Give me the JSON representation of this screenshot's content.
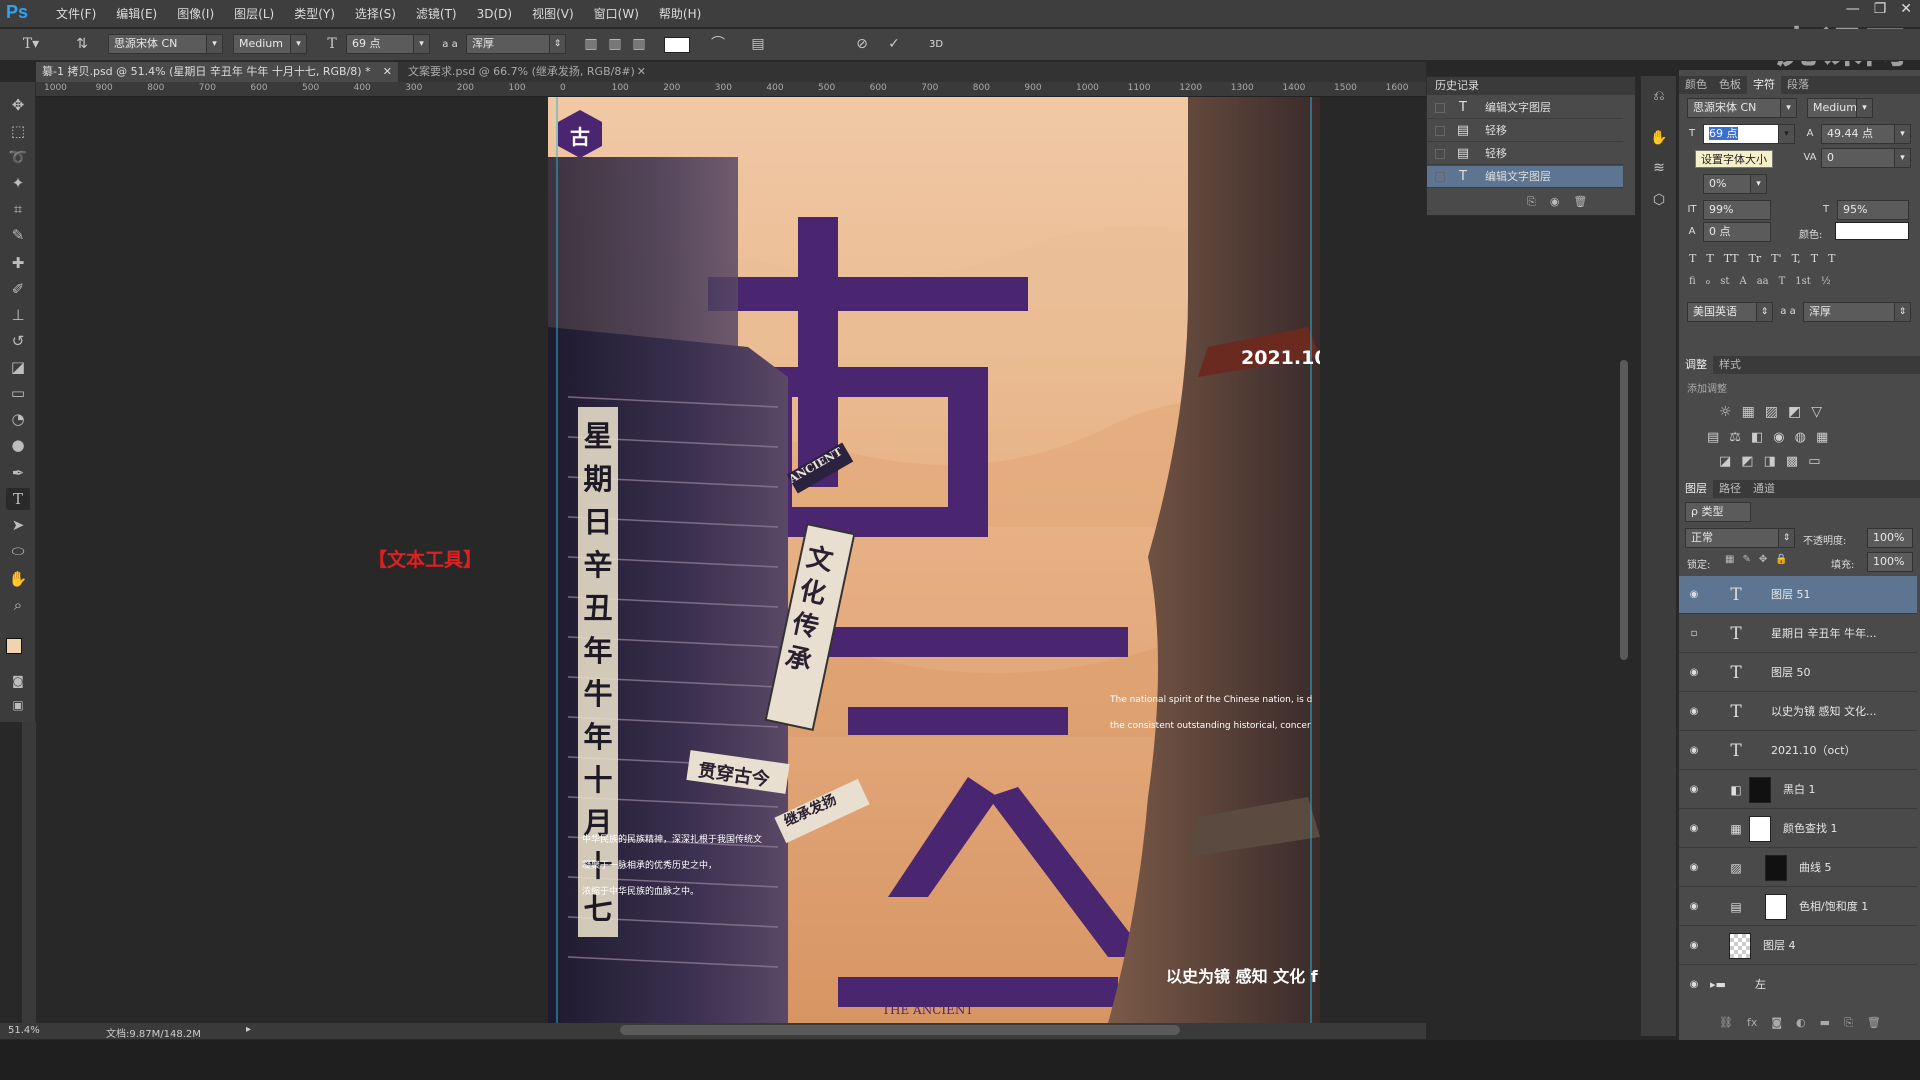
{
  "app": {
    "logo": "Ps"
  },
  "menu": [
    "文件(F)",
    "编辑(E)",
    "图像(I)",
    "图层(L)",
    "类型(Y)",
    "选择(S)",
    "滤镜(T)",
    "3D(D)",
    "视图(V)",
    "窗口(W)",
    "帮助(H)"
  ],
  "window_controls": [
    "—",
    "❐",
    "✕"
  ],
  "watermark": "虎课网",
  "options": {
    "font_family": "思源宋体 CN",
    "font_style": "Medium",
    "font_size": "69 点",
    "aa_mode": "浑厚",
    "aa_label": "a a",
    "three_d": "3D"
  },
  "tabs": [
    {
      "label": "纂-1 拷贝.psd @ 51.4% (星期日 辛丑年 牛年 十月十七, RGB/8) *",
      "close": "✕",
      "active": true
    },
    {
      "label": "文案要求.psd @ 66.7% (继承发扬, RGB/8#)",
      "close": "✕",
      "active": false
    }
  ],
  "ruler_labels": [
    "1000",
    "900",
    "800",
    "700",
    "600",
    "500",
    "400",
    "300",
    "200",
    "100",
    "0",
    "100",
    "200",
    "300",
    "400",
    "500",
    "600",
    "700",
    "800",
    "900",
    "1000",
    "1100",
    "1200",
    "1300",
    "1400",
    "1500",
    "1600"
  ],
  "canvas": {
    "annotation": "【文本工具】",
    "poster": {
      "badge": "古",
      "big_chars": [
        "古",
        "与",
        "今"
      ],
      "date": "2021.10",
      "vertical_date": [
        "星",
        "期",
        "日",
        "辛",
        "丑",
        "年",
        "牛",
        "年",
        "十",
        "月",
        "十",
        "七"
      ],
      "sign_ancient": "ANCIENT",
      "sign_culture": "文化传承",
      "sign_through": "贯穿古今",
      "sign_inherit": "继承发扬",
      "en_line1": "The national spirit of the Chinese nation, is d",
      "en_line2": "the consistent outstanding historical, concer",
      "cn_lines": [
        "中华民族的民族精神，深深扎根于我国传统文",
        "凝聚于一脉相承的优秀历史之中，",
        "浓缩于中华民族的血脉之中。"
      ],
      "cn_caption": "以史为镜 感知 文化 f",
      "footer": "THE ANCIENT"
    }
  },
  "status": {
    "zoom": "51.4%",
    "doc": "文档:9.87M/148.2M"
  },
  "history": {
    "title": "历史记录",
    "items": [
      {
        "label": "编辑文字图层",
        "icon": "T",
        "selected": false
      },
      {
        "label": "轻移",
        "icon": "▤",
        "selected": false
      },
      {
        "label": "轻移",
        "icon": "▤",
        "selected": false
      },
      {
        "label": "编辑文字图层",
        "icon": "T",
        "selected": true
      }
    ]
  },
  "character": {
    "tabs": [
      "颜色",
      "色板",
      "字符",
      "段落"
    ],
    "font_family": "思源宋体 CN",
    "font_style": "Medium",
    "size_value": "69 点",
    "leading": "49.44 点",
    "tracking": "0",
    "tooltip": "设置字体大小",
    "scale_pct": "0%",
    "vscale": "99%",
    "hscale": "95%",
    "baseline": "0 点",
    "color_label": "颜色:",
    "style_buttons": [
      "T",
      "T",
      "TT",
      "Tr",
      "T'",
      "T,",
      "T",
      "T"
    ],
    "ot_buttons": [
      "fi",
      "ℴ",
      "st",
      "A",
      "aa",
      "T",
      "1st",
      "½"
    ],
    "language": "美国英语",
    "aa_label": "a a",
    "aa_mode": "浑厚"
  },
  "adjustments": {
    "tabs": [
      "调整",
      "样式"
    ],
    "title": "添加调整"
  },
  "layers": {
    "tabs": [
      "图层",
      "路径",
      "通道"
    ],
    "filter": "ρ 类型",
    "blend": "正常",
    "opacity_label": "不透明度:",
    "opacity": "100%",
    "lock_label": "锁定:",
    "fill_label": "填充:",
    "fill": "100%",
    "items": [
      {
        "name": "图层 51",
        "type": "text",
        "visible": true,
        "selected": true
      },
      {
        "name": "星期日 辛丑年 牛年...",
        "type": "text",
        "visible": false,
        "selected": false
      },
      {
        "name": "图层 50",
        "type": "text",
        "visible": true,
        "selected": false
      },
      {
        "name": "以史为镜 感知 文化...",
        "type": "text",
        "visible": true,
        "selected": false
      },
      {
        "name": "2021.10（oct）",
        "type": "text",
        "visible": true,
        "selected": false
      },
      {
        "name": "黑白 1",
        "type": "adjust",
        "visible": true,
        "selected": false
      },
      {
        "name": "颜色查找 1",
        "type": "adjust",
        "visible": true,
        "selected": false
      },
      {
        "name": "曲线 5",
        "type": "adjust",
        "visible": true,
        "selected": false
      },
      {
        "name": "色相/饱和度 1",
        "type": "adjust",
        "visible": true,
        "selected": false
      },
      {
        "name": "图层 4",
        "type": "pixel",
        "visible": true,
        "selected": false
      },
      {
        "name": "左",
        "type": "group",
        "visible": true,
        "selected": false
      }
    ]
  },
  "colors": {
    "accent": "#4b2670",
    "select": "#5e7592",
    "annotation": "#e02020"
  }
}
